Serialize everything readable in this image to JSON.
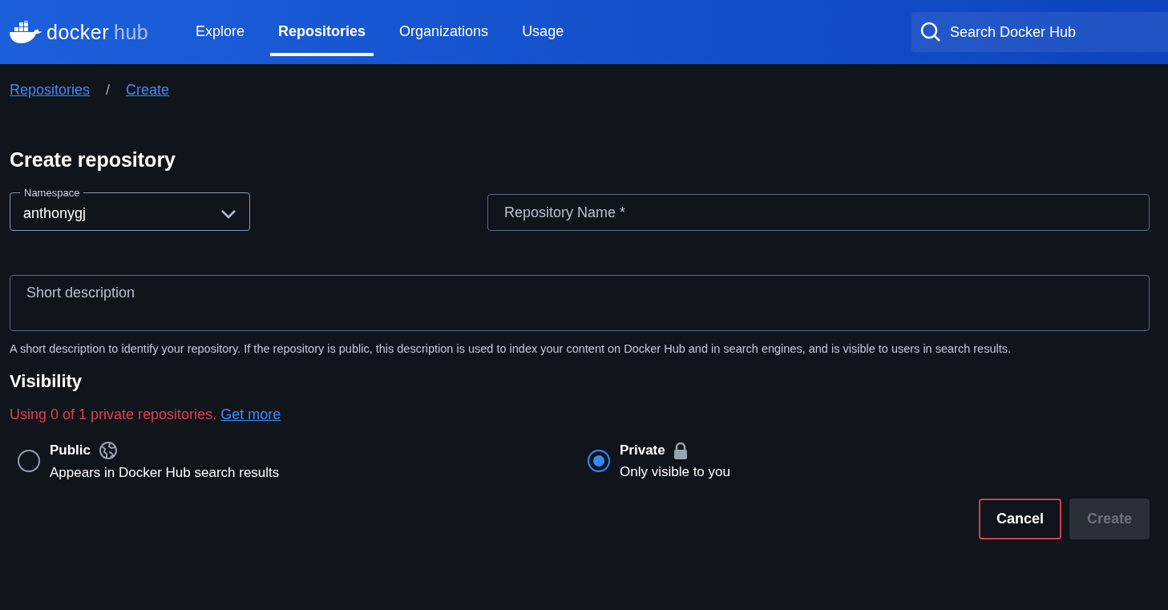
{
  "header": {
    "logo": {
      "word": "docker",
      "suffix": "hub"
    },
    "nav": [
      {
        "label": "Explore",
        "selected": false
      },
      {
        "label": "Repositories",
        "selected": true
      },
      {
        "label": "Organizations",
        "selected": false
      },
      {
        "label": "Usage",
        "selected": false
      }
    ],
    "search": {
      "placeholder": "Search Docker Hub"
    }
  },
  "breadcrumbs": {
    "items": [
      "Repositories",
      "Create"
    ],
    "separator": "/"
  },
  "title": "Create repository",
  "namespace": {
    "label": "Namespace",
    "value": "anthonygj"
  },
  "repository_name": {
    "placeholder": "Repository Name *"
  },
  "short_description": {
    "placeholder": "Short description",
    "help": "A short description to identify your repository. If the repository is public, this description is used to index your content on Docker Hub and in search engines, and is visible to users in search results."
  },
  "visibility": {
    "heading": "Visibility",
    "usage": "Using 0 of 1 private repositories.",
    "link": "Get more",
    "options": [
      {
        "kind": "public",
        "label": "Public",
        "description": "Appears in Docker Hub search results",
        "selected": false
      },
      {
        "kind": "private",
        "label": "Private",
        "description": "Only visible to you",
        "selected": true
      }
    ]
  },
  "buttons": [
    {
      "kind": "cancel",
      "label": "Cancel",
      "disabled": false
    },
    {
      "kind": "create",
      "label": "Create",
      "disabled": true
    }
  ]
}
